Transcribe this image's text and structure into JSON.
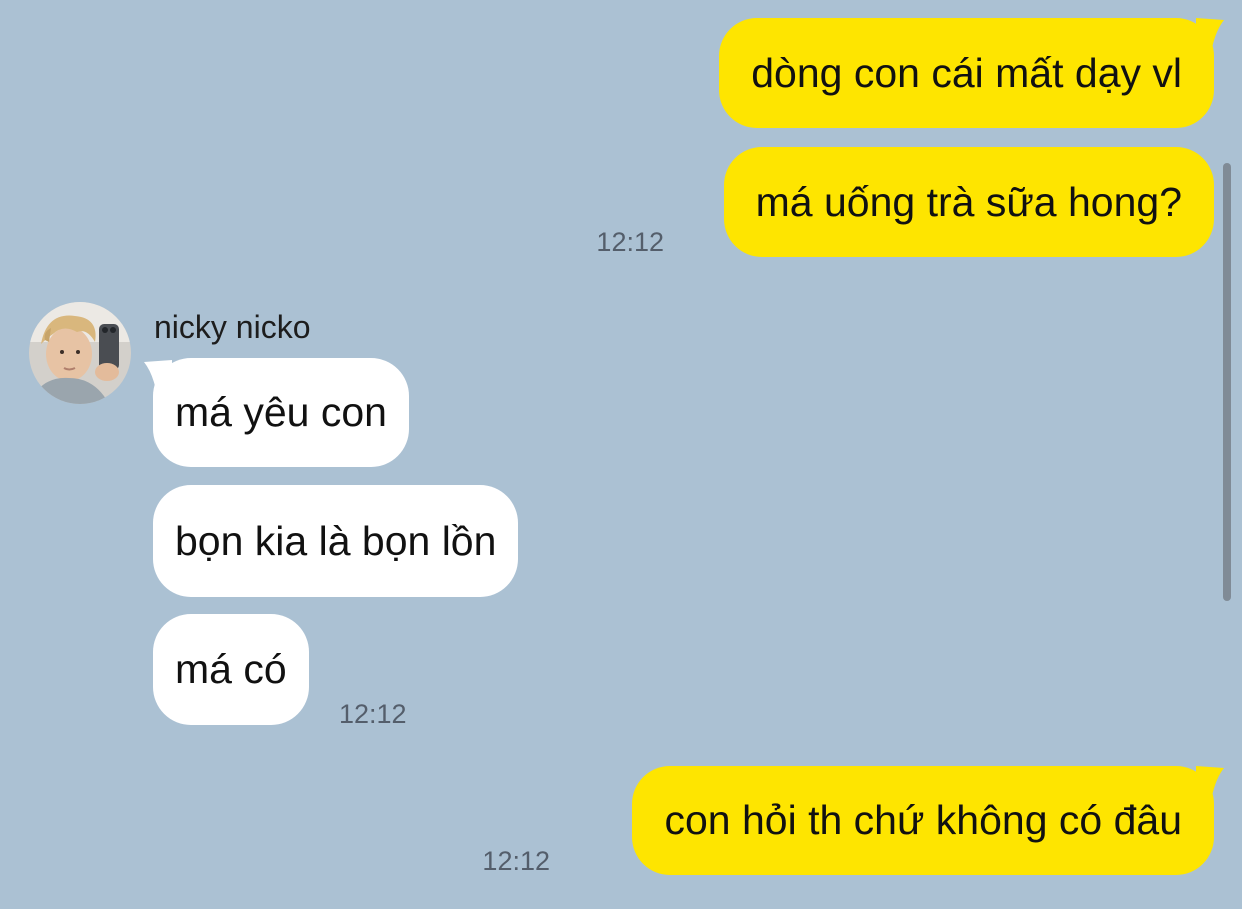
{
  "contact": {
    "name": "nicky nicko",
    "avatar_icon": "profile-photo"
  },
  "colors": {
    "background": "#abc1d3",
    "my_bubble": "#fee500",
    "their_bubble": "#ffffff",
    "timestamp_text": "#545e6b"
  },
  "messages": [
    {
      "sender": "me",
      "text": "dòng con cái mất dạy vl"
    },
    {
      "sender": "me",
      "text": "má uống trà sữa hong?",
      "time": "12:12"
    },
    {
      "sender": "contact",
      "text": "má yêu con"
    },
    {
      "sender": "contact",
      "text": "bọn kia là bọn lồn"
    },
    {
      "sender": "contact",
      "text": "má có",
      "time": "12:12"
    },
    {
      "sender": "me",
      "text": "con hỏi th chứ không có đâu",
      "time": "12:12"
    }
  ]
}
